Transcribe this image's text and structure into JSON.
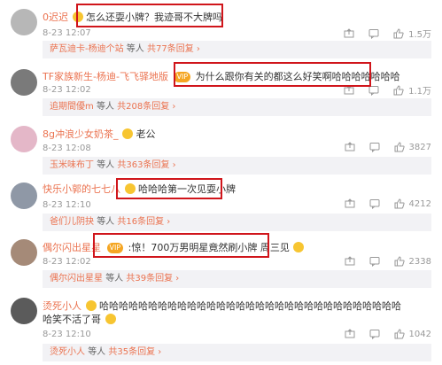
{
  "comments": [
    {
      "username": "0迟迟",
      "badge": "",
      "text": "怎么还耍小牌？我迹哥不大牌吗",
      "time": "8-23 12:07",
      "likes": "1.5万",
      "reply_user": "萨瓦迪卡-杨迪个站",
      "reply_mid": "等人",
      "reply_link": "共77条回复",
      "avatar_color": "#b7b7b7"
    },
    {
      "username": "TF家族新生-杨迪-飞飞驿地版",
      "badge": "VIP",
      "text": "为什么跟你有关的都这么好笑啊哈哈哈哈哈哈哈",
      "time": "8-23 12:02",
      "likes": "1.1万",
      "reply_user": "追期間優m",
      "reply_mid": "等人",
      "reply_link": "共208条回复",
      "avatar_color": "#7a7a7a"
    },
    {
      "username": "8g冲浪少女奶茶_",
      "badge": "",
      "text": "老公",
      "time": "8-23 12:08",
      "likes": "3827",
      "reply_user": "玉米味布丁",
      "reply_mid": "等人",
      "reply_link": "共363条回复",
      "avatar_color": "#e4b7c8"
    },
    {
      "username": "快乐小郭的七七八",
      "badge": "",
      "text": "哈哈哈第一次见耍小牌",
      "time": "8-23 12:10",
      "likes": "4212",
      "reply_user": "爸们儿阴抉",
      "reply_mid": "等人",
      "reply_link": "共16条回复",
      "avatar_color": "#8f98a6"
    },
    {
      "username": "偶尔闪出星星",
      "badge": "VIP",
      "text": ":惊！700万男明星竟然刷小牌 周三见",
      "time": "8-23 12:02",
      "likes": "2338",
      "reply_user": "偶尔闪出星星",
      "reply_mid": "等人",
      "reply_link": "共39条回复",
      "avatar_color": "#a58a78"
    },
    {
      "username": "烫死小人",
      "badge": "",
      "text": "哈哈哈哈哈哈哈哈哈哈哈哈哈哈哈哈哈哈哈哈哈哈哈哈哈哈哈哈哈哈哈哈笑不活了哥",
      "time": "8-23 12:10",
      "likes": "1042",
      "reply_user": "烫死小人",
      "reply_mid": "等人",
      "reply_link": "共35条回复",
      "avatar_color": "#5b5b5b"
    }
  ],
  "icons": {
    "share": "share-icon",
    "comment": "comment-icon",
    "like": "thumbs-up-icon",
    "chevron": "chevron-right-icon"
  },
  "colors": {
    "username": "#eb7350",
    "highlight_box": "#d0151b",
    "reply_bg": "#f2f2f5",
    "meta": "#999999"
  }
}
